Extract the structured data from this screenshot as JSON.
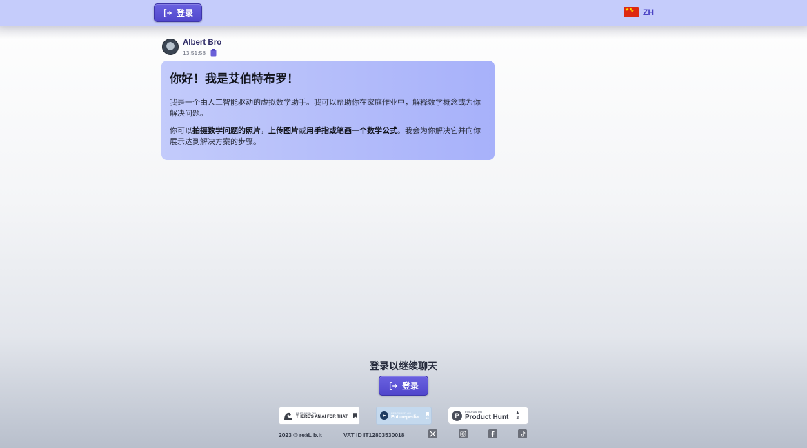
{
  "header": {
    "login_label": "登录",
    "lang_code": "ZH"
  },
  "message": {
    "sender": "Albert Bro",
    "time": "13:51:58",
    "title": "你好！我是艾伯特布罗！",
    "para1": "我是一个由人工智能驱动的虚拟数学助手。我可以帮助你在家庭作业中，解释数学概念或为你解决问题。",
    "para2_a": "你可以",
    "para2_b": "拍摄数学问题的照片",
    "para2_c": "，",
    "para2_d": "上传图片",
    "para2_e": "或",
    "para2_f": "用手指或笔画一个数学公式",
    "para2_g": "。我会为你解决它并向你展示达到解决方案的步骤。"
  },
  "cta": {
    "prompt": "登录以继续聊天",
    "login_label": "登录"
  },
  "footer": {
    "badges": {
      "aift_small": "FEATURED ON",
      "aift_big": "THERE'S AN AI FOR THAT",
      "fp_small": "FEATURED ON",
      "fp_big": "Futurepedia",
      "fp_count": "15",
      "ph_small": "FIND US ON",
      "ph_big": "Product Hunt",
      "ph_count": "2"
    },
    "copyright": "2023 © reàL b.it",
    "vat": "VAT ID IT12803530018"
  },
  "colors": {
    "topbar": "#c5ccfb",
    "button": "#5147cc",
    "bubble": "#b2bbfa",
    "lang_text": "#4b44c4"
  },
  "icons": [
    "login-icon",
    "china-flag-icon",
    "avatar",
    "copy-icon",
    "bookmark-icon",
    "product-hunt-icon",
    "x-icon",
    "instagram-icon",
    "facebook-icon",
    "tiktok-icon"
  ]
}
